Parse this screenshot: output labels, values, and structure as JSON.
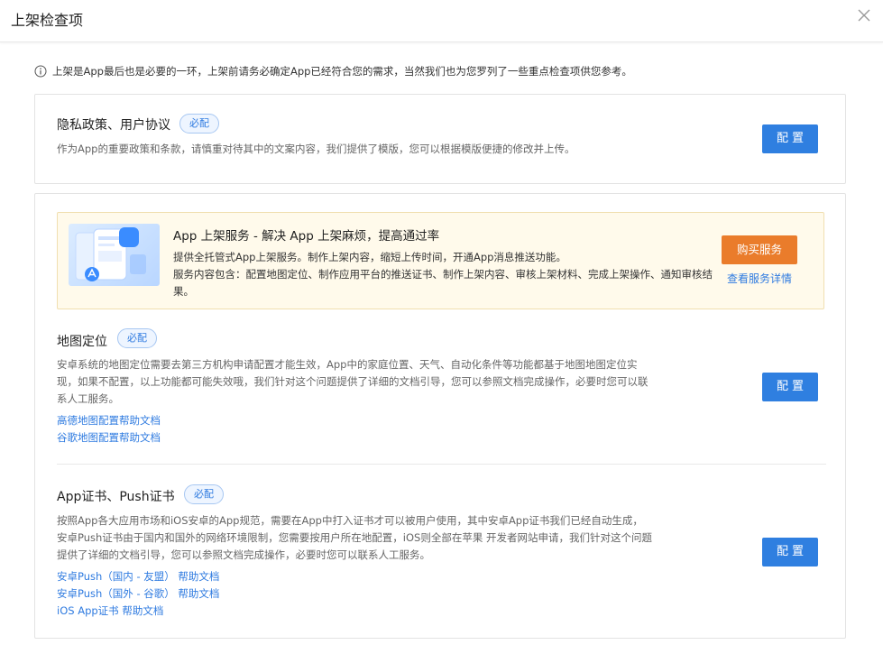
{
  "header": {
    "title": "上架检查项"
  },
  "notice": {
    "text": "上架是App最后也是必要的一环，上架前请务必确定App已经符合您的需求，当然我们也为您罗列了一些重点检查项供您参考。"
  },
  "privacy": {
    "title": "隐私政策、用户协议",
    "badge": "必配",
    "desc": "作为App的重要政策和条款，请慎重对待其中的文案内容，我们提供了模版，您可以根据模版便捷的修改并上传。",
    "button": "配置"
  },
  "promo": {
    "title": "App 上架服务 - 解决 App 上架麻烦，提高通过率",
    "desc_line1": "提供全托管式App上架服务。制作上架内容，缩短上传时间，开通App消息推送功能。",
    "desc_line2": "服务内容包含：配置地图定位、制作应用平台的推送证书、制作上架内容、审核上架材料、完成上架操作、通知审核结果。",
    "buy_button": "购买服务",
    "detail_link": "查看服务详情"
  },
  "map": {
    "title": "地图定位",
    "badge": "必配",
    "desc": "安卓系统的地图定位需要去第三方机构申请配置才能生效，App中的家庭位置、天气、自动化条件等功能都基于地图地图定位实现，如果不配置，以上功能都可能失效哦，我们针对这个问题提供了详细的文档引导，您可以参照文档完成操作，必要时您可以联系人工服务。",
    "button": "配置",
    "links": [
      "高德地图配置帮助文档",
      "谷歌地图配置帮助文档"
    ]
  },
  "cert": {
    "title": "App证书、Push证书",
    "badge": "必配",
    "desc": "按照App各大应用市场和iOS安卓的App规范，需要在App中打入证书才可以被用户使用，其中安卓App证书我们已经自动生成，安卓Push证书由于国内和国外的网络环境限制，您需要按用户所在地配置，iOS则全部在苹果 开发者网站申请，我们针对这个问题提供了详细的文档引导，您可以参照文档完成操作，必要时您可以联系人工服务。",
    "button": "配置",
    "links": [
      "安卓Push（国内 - 友盟） 帮助文档",
      "安卓Push（国外 - 谷歌） 帮助文档",
      "iOS App证书 帮助文档"
    ]
  },
  "colors": {
    "primary": "#2f7fe0",
    "orange": "#ea7c2b",
    "promo_bg": "#fffaeb"
  },
  "icons": {
    "close": "close-icon",
    "info": "info-icon"
  }
}
